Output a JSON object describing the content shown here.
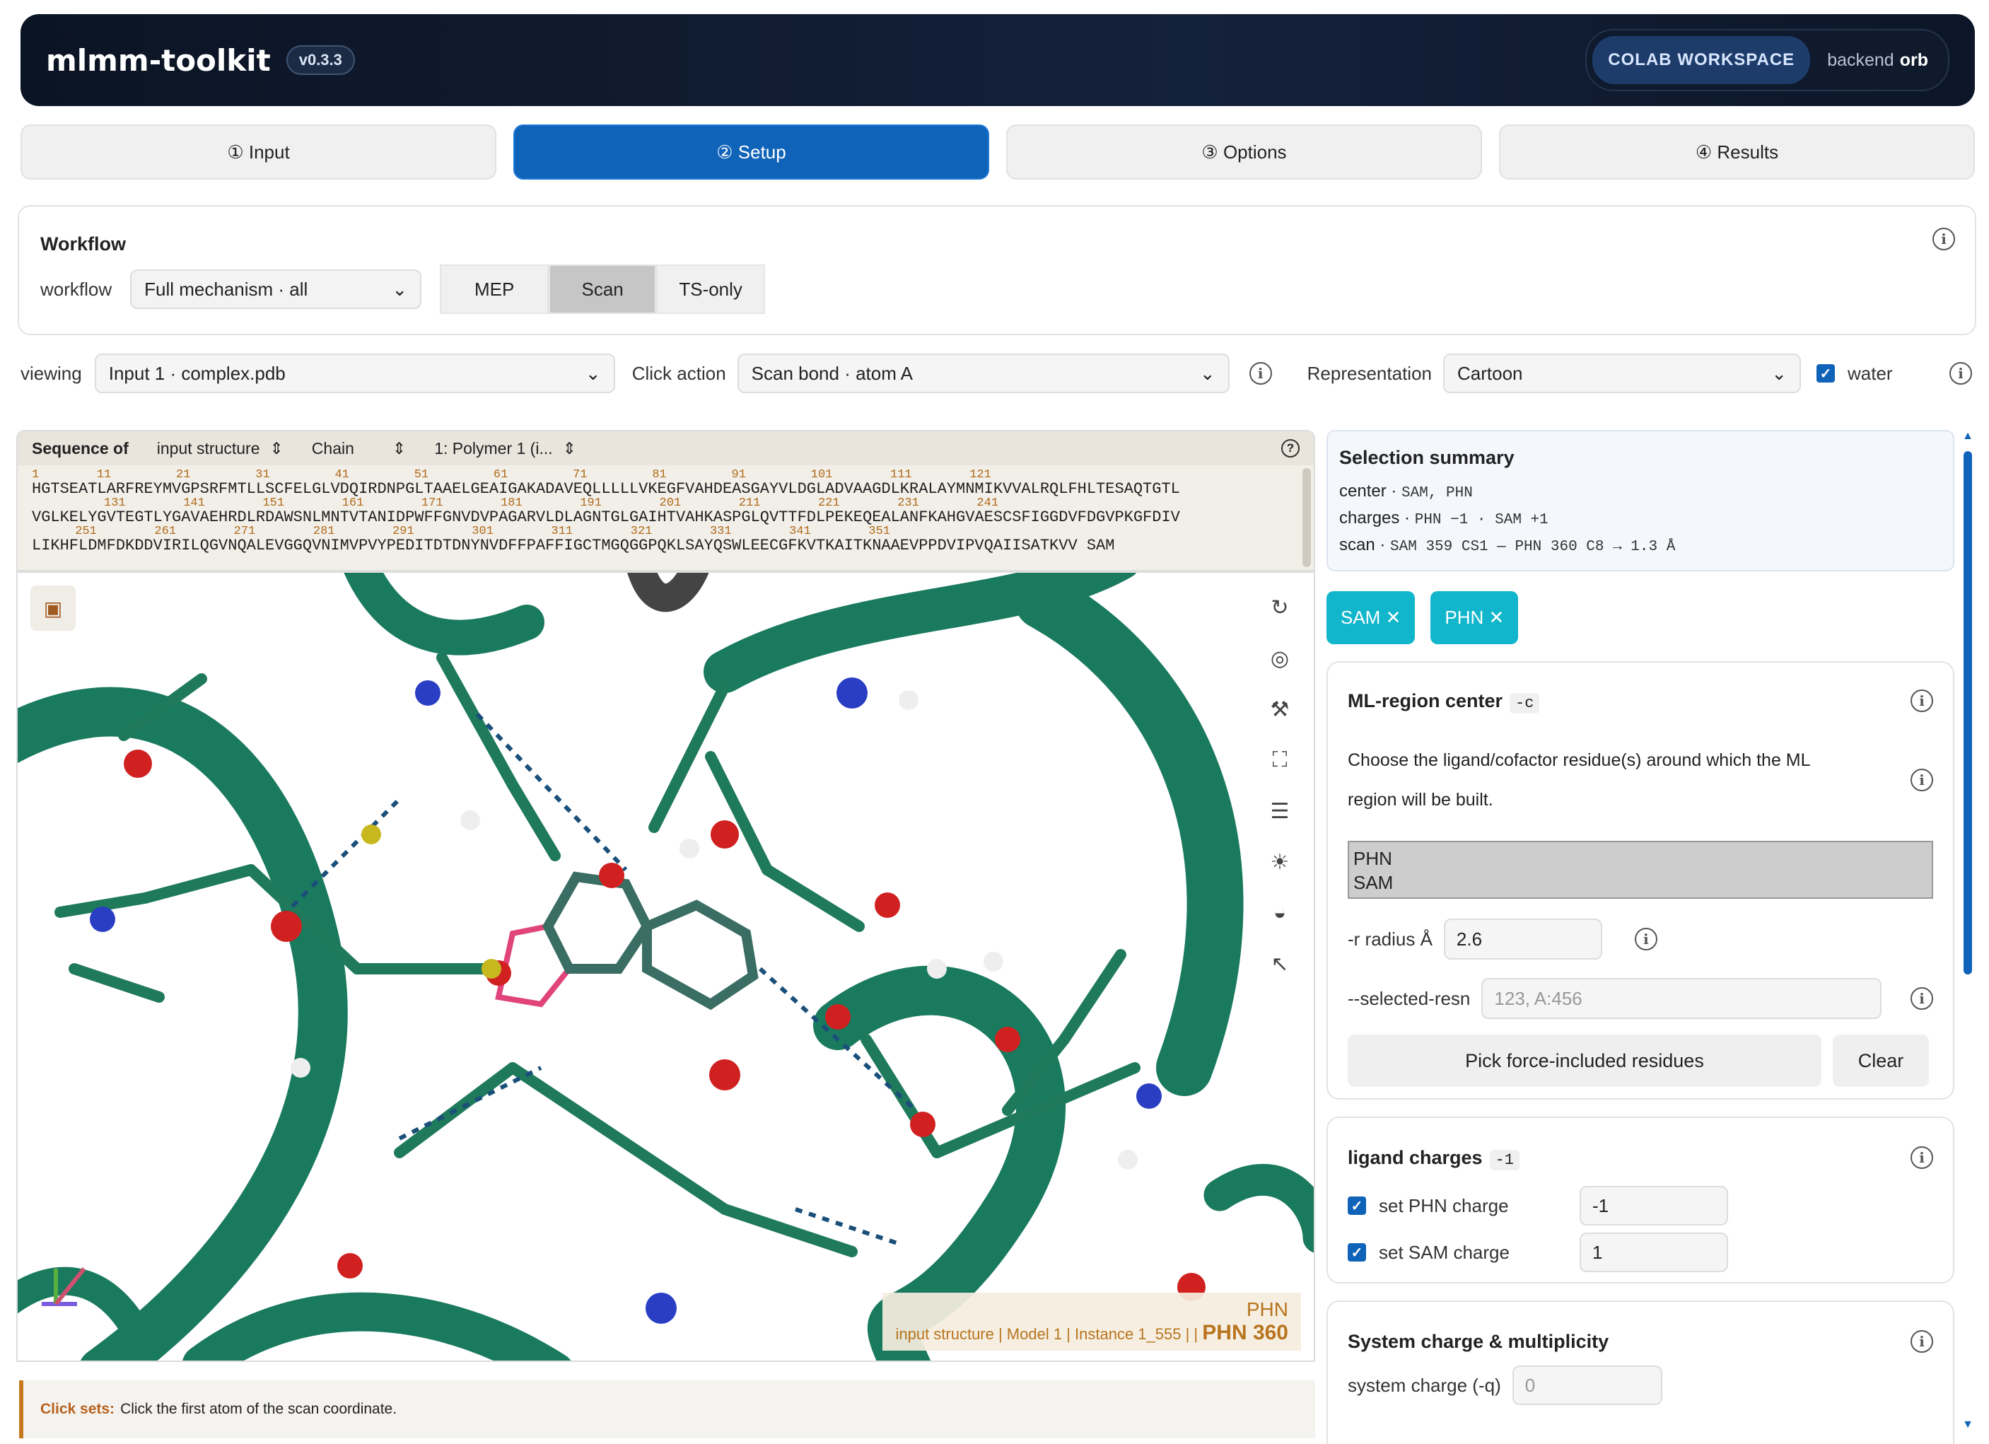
{
  "header": {
    "app_name": "mlmm-toolkit",
    "version": "v0.3.3",
    "workspace": "COLAB WORKSPACE",
    "backend_label": "backend",
    "backend_value": "orb"
  },
  "tabs": [
    {
      "label": "① Input"
    },
    {
      "label": "② Setup"
    },
    {
      "label": "③ Options"
    },
    {
      "label": "④ Results"
    }
  ],
  "workflow": {
    "title": "Workflow",
    "label": "workflow",
    "selected": "Full mechanism · all",
    "modes": [
      "MEP",
      "Scan",
      "TS-only"
    ],
    "active_mode": "Scan"
  },
  "controls": {
    "viewing_label": "viewing",
    "viewing_value": "Input 1 · complex.pdb",
    "click_label": "Click action",
    "click_value": "Scan bond · atom A",
    "repr_label": "Representation",
    "repr_value": "Cartoon",
    "water_label": "water"
  },
  "sequence": {
    "label": "Sequence of",
    "source": "input structure",
    "chain": "Chain",
    "polymer": "1: Polymer 1 (i...",
    "nums1": "1        11         21         31         41         51         61         71         81         91         101        111        121",
    "line1": "HGTSEATLARFREYMVGPSRFMTLLSCFELGLVDQIRDNPGLTAAELGEAIGAKADAVEQLLLLLVKEGFVAHDEASGAYVLDGLADVAAGDLKRALAYMNMIKVVALRQLFHLTESAQTGTL",
    "nums2": "          131        141        151        161        171        181        191        201        211        221        231        241",
    "line2": "VGLKELYGVTEGTLYGAVAEHRDLRDAWSNLMNTVTANIDPWFFGNVDVPAGARVLDLAGNTGLGAIHTVAHKASPGLQVTTFDLPEKEQEALANFKAHGVAESCSFIGGDVFDGVPKGFDIV",
    "nums3": "      251        261        271        281        291        301        311        321        331        341        351",
    "line3": "LIKHFLDMFDKDDVIRILQGVNQALEVGGQVNIMVPVYPEDITDTDNYNVDFFPAFFIGCTMGQGGPQKLSAYQSWLEECGFKVTKAITKNAAEVPPDVIPVQAIISATKVV SAM"
  },
  "viewer": {
    "legend_top": "PHN",
    "legend_path": "input structure | Model 1 | Instance 1_555 | |",
    "legend_residue": "PHN 360"
  },
  "clickbar": {
    "label": "Click sets:",
    "text": "Click the first atom of the scan coordinate."
  },
  "summary": {
    "title": "Selection summary",
    "center_label": "center ·",
    "center_value": "SAM, PHN",
    "charges_label": "charges ·",
    "charges_value": "PHN −1 · SAM +1",
    "scan_label": "scan ·",
    "scan_value": "SAM 359 CS1 — PHN 360 C8 → 1.3 Å"
  },
  "chips": [
    "SAM ✕",
    "PHN ✕"
  ],
  "ml_center": {
    "title": "ML-region center",
    "flag": "-c",
    "desc": "Choose the ligand/cofactor residue(s) around which the ML region will be built.",
    "options": [
      "PHN",
      "SAM"
    ],
    "radius_label": "-r radius Å",
    "radius_value": "2.6",
    "selected_label": "--selected-resn",
    "selected_placeholder": "123, A:456",
    "pick_button": "Pick force-included residues",
    "clear_button": "Clear"
  },
  "charges": {
    "title": "ligand charges",
    "flag": "-1",
    "rows": [
      {
        "label": "set PHN charge",
        "value": "-1"
      },
      {
        "label": "set SAM charge",
        "value": "1"
      }
    ]
  },
  "system": {
    "title": "System charge & multiplicity",
    "charge_label": "system charge (-q)",
    "charge_placeholder": "0"
  },
  "colors": {
    "accent": "#0f63b8",
    "chip": "#12b6cc",
    "protein": "#1a7a5e",
    "ligand_highlight": "#e0447a"
  }
}
